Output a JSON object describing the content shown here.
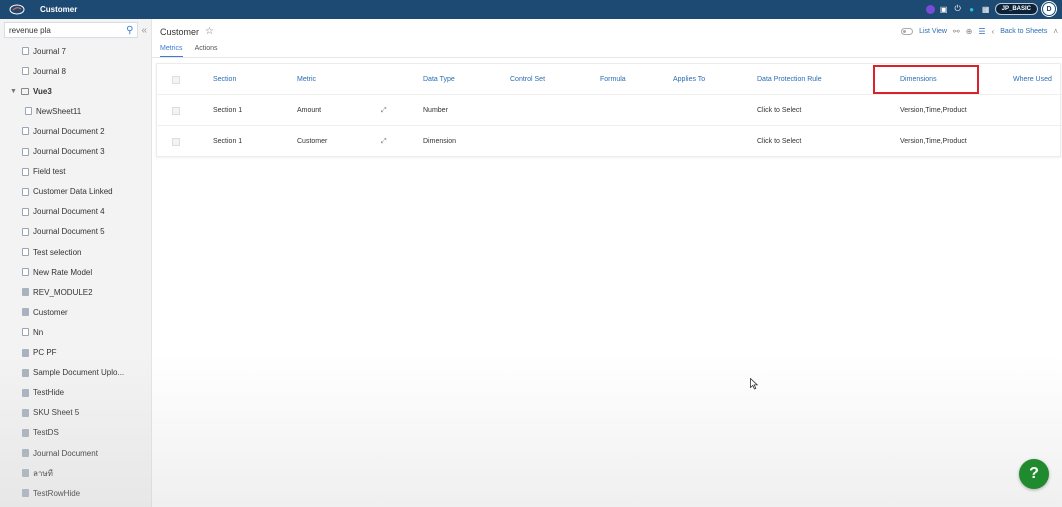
{
  "app": {
    "title": "Customer",
    "user_badge": "JP_BASIC",
    "avatar_initial": "D"
  },
  "sidebar": {
    "search_value": "revenue pla",
    "items": [
      {
        "label": "Journal 7",
        "icon": "document-icon"
      },
      {
        "label": "Journal 8",
        "icon": "document-icon"
      },
      {
        "label": "Vue3",
        "icon": "folder-icon",
        "expanded": true
      },
      {
        "label": "NewSheet11",
        "icon": "document-icon"
      },
      {
        "label": "Journal Document 2",
        "icon": "document-icon"
      },
      {
        "label": "Journal Document 3",
        "icon": "document-icon"
      },
      {
        "label": "Field test",
        "icon": "document-icon"
      },
      {
        "label": "Customer Data Linked",
        "icon": "document-icon"
      },
      {
        "label": "Journal Document 4",
        "icon": "document-icon"
      },
      {
        "label": "Journal Document 5",
        "icon": "document-icon"
      },
      {
        "label": "Test selection",
        "icon": "sheet-icon"
      },
      {
        "label": "New Rate Model",
        "icon": "sheet-icon"
      },
      {
        "label": "REV_MODULE2",
        "icon": "module-icon"
      },
      {
        "label": "Customer",
        "icon": "document-icon"
      },
      {
        "label": "Nn",
        "icon": "sheet-icon"
      },
      {
        "label": "PC PF",
        "icon": "document-icon"
      },
      {
        "label": "Sample Document Uplo...",
        "icon": "document-icon"
      },
      {
        "label": "TestHide",
        "icon": "document-icon"
      },
      {
        "label": "SKU Sheet 5",
        "icon": "document-icon"
      },
      {
        "label": "TestDS",
        "icon": "document-icon"
      },
      {
        "label": "Journal Document",
        "icon": "document-icon"
      },
      {
        "label": "ลาษที",
        "icon": "document-icon"
      },
      {
        "label": "TestRowHide",
        "icon": "document-icon"
      }
    ]
  },
  "main": {
    "sheet_title": "Customer",
    "tabs": [
      {
        "label": "Metrics",
        "active": true
      },
      {
        "label": "Actions",
        "active": false
      }
    ],
    "toolbar": {
      "list_view": "List View",
      "back_to_sheets": "Back to Sheets"
    },
    "table": {
      "columns": [
        "Section",
        "Metric",
        "Data Type",
        "Control Set",
        "Formula",
        "Applies To",
        "Data Protection Rule",
        "Dimensions",
        "Where Used"
      ],
      "rows": [
        {
          "section": "Section 1",
          "metric": "Amount",
          "data_type": "Number",
          "control_set": "",
          "formula": "",
          "applies_to": "",
          "data_protection_rule": "Click to Select",
          "dimensions": "Version,Time,Product",
          "where_used": ""
        },
        {
          "section": "Section 1",
          "metric": "Customer",
          "data_type": "Dimension",
          "control_set": "",
          "formula": "",
          "applies_to": "",
          "data_protection_rule": "Click to Select",
          "dimensions": "Version,Time,Product",
          "where_used": ""
        }
      ]
    }
  },
  "help_label": "?",
  "colors": {
    "topbar": "#1d4a72",
    "accent": "#3a7bd5",
    "highlight": "#d9232b",
    "help": "#1f8b2e"
  }
}
